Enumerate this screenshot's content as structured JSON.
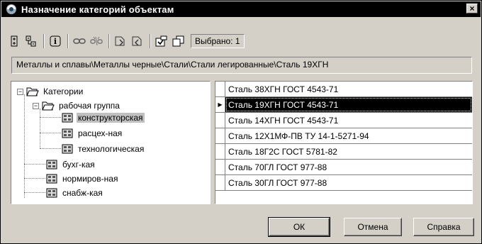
{
  "window": {
    "title": "Назначение категорий объектам",
    "close_label": "×"
  },
  "toolbar": {
    "icons": [
      "expand-all-icon",
      "collapse-all-icon",
      "info-icon",
      "link-icon",
      "unlink-icon",
      "assign-category-icon",
      "remove-category-icon",
      "select-all-icon",
      "copy-icon"
    ],
    "selected_count": "Выбрано: 1"
  },
  "path_bar": {
    "path": "Металлы и сплавы\\Металлы черные\\Стали\\Стали легированные\\Сталь 19ХГН"
  },
  "tree": {
    "root": {
      "label": "Категории",
      "expander": "−"
    },
    "group": {
      "label": "рабочая группа",
      "expander": "−"
    },
    "children": [
      {
        "label": "конструкторская",
        "selected": true
      },
      {
        "label": "расцех-ная"
      },
      {
        "label": "технологическая"
      }
    ],
    "siblings": [
      {
        "label": "бухг-кая"
      },
      {
        "label": "нормиров-ная"
      },
      {
        "label": "снабж-кая"
      }
    ]
  },
  "grid": {
    "rows": [
      "Сталь 38ХГН ГОСТ 4543-71",
      "Сталь 19ХГН ГОСТ 4543-71",
      "Сталь 14ХГН ГОСТ 4543-71",
      "Сталь 12Х1МФ-ПВ ТУ 14-1-5271-94",
      "Сталь 18Г2С ГОСТ 5781-82",
      "Сталь 70ГЛ ГОСТ 977-88",
      "Сталь 30ГЛ ГОСТ 977-88"
    ],
    "active_row_index": 1,
    "active_marker": "▶"
  },
  "buttons": {
    "ok": "ОК",
    "cancel": "Отмена",
    "help": "Справка"
  }
}
